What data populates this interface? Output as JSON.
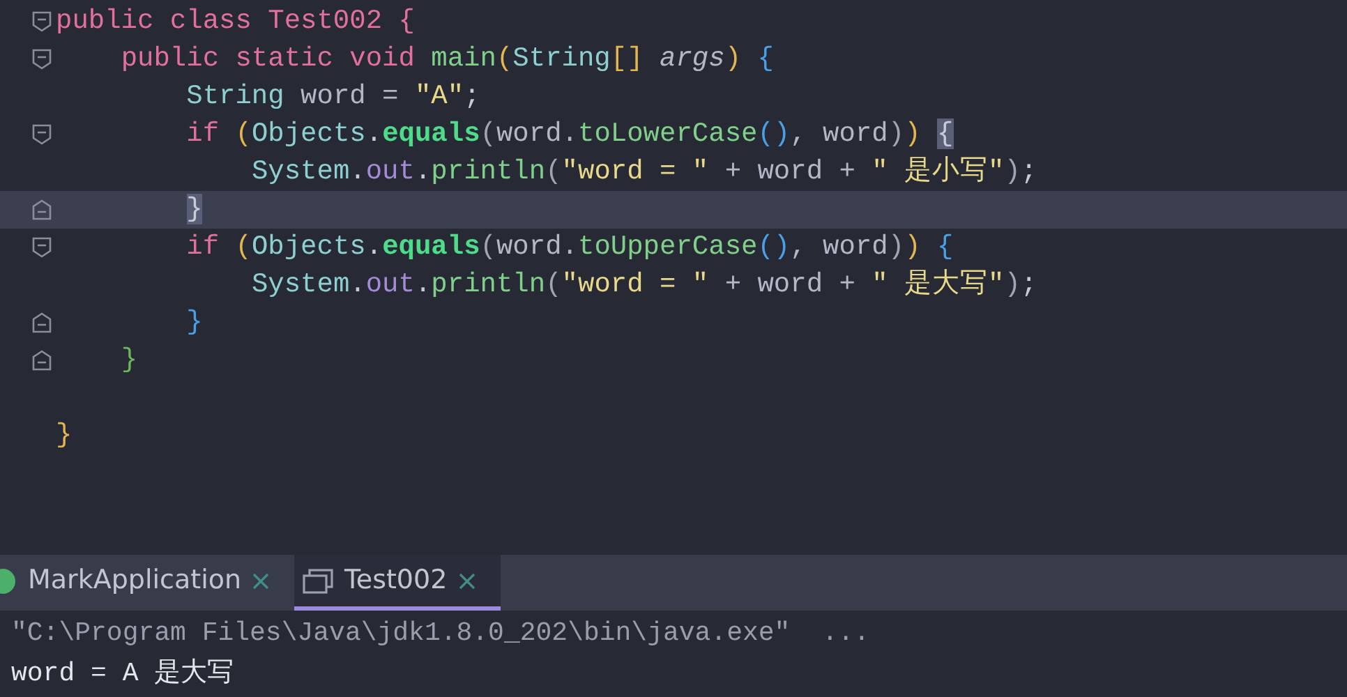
{
  "editor": {
    "lines": [
      {
        "kind": "fold_start",
        "current": false,
        "tokens": [
          {
            "text": "public class Test002 {",
            "kind": "keyword"
          }
        ]
      },
      {
        "kind": "fold_start",
        "current": false,
        "tokens": [
          {
            "text": "    public static void ",
            "kind": "keyword"
          },
          {
            "text": "main",
            "kind": "method"
          },
          {
            "text": "(",
            "kind": "paren1"
          },
          {
            "text": "String",
            "kind": "type"
          },
          {
            "text": "[] ",
            "kind": "paren1"
          },
          {
            "text": "args",
            "kind": "param"
          },
          {
            "text": ") ",
            "kind": "paren1"
          },
          {
            "text": "{",
            "kind": "paren2"
          }
        ]
      },
      {
        "kind": "plain",
        "current": false,
        "tokens": [
          {
            "text": "        String",
            "kind": "type"
          },
          {
            "text": " word = ",
            "kind": "ident"
          },
          {
            "text": "\"A\"",
            "kind": "string"
          },
          {
            "text": ";",
            "kind": "plain"
          }
        ]
      },
      {
        "kind": "fold_start",
        "current": false,
        "tokens": [
          {
            "text": "        if ",
            "kind": "keyword"
          },
          {
            "text": "(",
            "kind": "paren1"
          },
          {
            "text": "Objects",
            "kind": "type"
          },
          {
            "text": ".",
            "kind": "plain"
          },
          {
            "text": "equals",
            "kind": "static_method"
          },
          {
            "text": "(",
            "kind": "paren3"
          },
          {
            "text": "word.",
            "kind": "ident"
          },
          {
            "text": "toLowerCase",
            "kind": "method"
          },
          {
            "text": "()",
            "kind": "paren2"
          },
          {
            "text": ", word",
            "kind": "ident"
          },
          {
            "text": ")",
            "kind": "paren3"
          },
          {
            "text": ") ",
            "kind": "paren1"
          },
          {
            "text": "{",
            "kind": "brace_match"
          }
        ]
      },
      {
        "kind": "plain",
        "current": false,
        "tokens": [
          {
            "text": "            System",
            "kind": "type"
          },
          {
            "text": ".",
            "kind": "plain"
          },
          {
            "text": "out",
            "kind": "field"
          },
          {
            "text": ".",
            "kind": "plain"
          },
          {
            "text": "println",
            "kind": "method"
          },
          {
            "text": "(",
            "kind": "paren3"
          },
          {
            "text": "\"word = \"",
            "kind": "string"
          },
          {
            "text": " + word + ",
            "kind": "ident"
          },
          {
            "text": "\" 是小写\"",
            "kind": "string"
          },
          {
            "text": ")",
            "kind": "paren3"
          },
          {
            "text": ";",
            "kind": "plain"
          }
        ]
      },
      {
        "kind": "fold_end",
        "current": true,
        "tokens": [
          {
            "text": "        }",
            "kind": "brace_match"
          }
        ]
      },
      {
        "kind": "fold_start",
        "current": false,
        "tokens": [
          {
            "text": "        if ",
            "kind": "keyword"
          },
          {
            "text": "(",
            "kind": "paren1"
          },
          {
            "text": "Objects",
            "kind": "type"
          },
          {
            "text": ".",
            "kind": "plain"
          },
          {
            "text": "equals",
            "kind": "static_method"
          },
          {
            "text": "(",
            "kind": "paren3"
          },
          {
            "text": "word.",
            "kind": "ident"
          },
          {
            "text": "toUpperCase",
            "kind": "method"
          },
          {
            "text": "()",
            "kind": "paren2"
          },
          {
            "text": ", word",
            "kind": "ident"
          },
          {
            "text": ")",
            "kind": "paren3"
          },
          {
            "text": ") ",
            "kind": "paren1"
          },
          {
            "text": "{",
            "kind": "paren2"
          }
        ]
      },
      {
        "kind": "plain",
        "current": false,
        "tokens": [
          {
            "text": "            System",
            "kind": "type"
          },
          {
            "text": ".",
            "kind": "plain"
          },
          {
            "text": "out",
            "kind": "field"
          },
          {
            "text": ".",
            "kind": "plain"
          },
          {
            "text": "println",
            "kind": "method"
          },
          {
            "text": "(",
            "kind": "paren3"
          },
          {
            "text": "\"word = \"",
            "kind": "string"
          },
          {
            "text": " + word + ",
            "kind": "ident"
          },
          {
            "text": "\" 是大写\"",
            "kind": "string"
          },
          {
            "text": ")",
            "kind": "paren3"
          },
          {
            "text": ";",
            "kind": "plain"
          }
        ]
      },
      {
        "kind": "fold_end",
        "current": false,
        "tokens": [
          {
            "text": "        }",
            "kind": "paren2"
          }
        ]
      },
      {
        "kind": "fold_end",
        "current": false,
        "tokens": [
          {
            "text": "    }",
            "kind": "paren4"
          }
        ]
      },
      {
        "kind": "blank",
        "current": false
      },
      {
        "kind": "plain",
        "current": false,
        "tokens": [
          {
            "text": "}",
            "kind": "paren1"
          }
        ]
      }
    ]
  },
  "run_tabs": [
    {
      "label": "MarkApplication",
      "selected": false,
      "kind": "app"
    },
    {
      "label": "Test002",
      "selected": true,
      "kind": "window"
    }
  ],
  "console": {
    "lines": [
      {
        "text": "\"C:\\Program Files\\Java\\jdk1.8.0_202\\bin\\java.exe\"  ...",
        "kind": "command"
      },
      {
        "text": "word = A 是大写",
        "kind": "output"
      }
    ]
  }
}
